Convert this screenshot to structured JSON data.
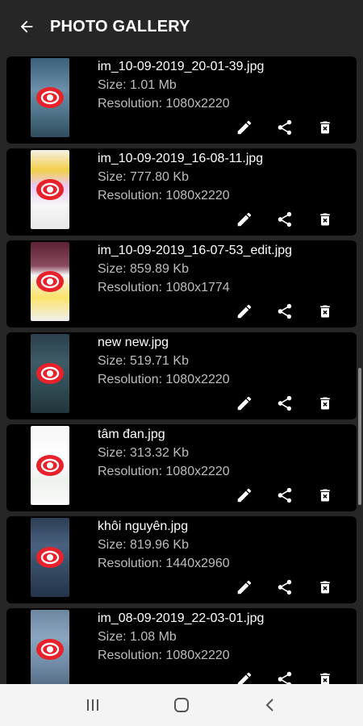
{
  "appbar": {
    "title": "PHOTO GALLERY",
    "back_icon": "arrow-back-icon"
  },
  "icons": {
    "edit": "pencil-icon",
    "share": "share-icon",
    "delete": "trash-icon"
  },
  "colors": {
    "background": "#262626",
    "card": "#000000",
    "eye_red": "#e8212b"
  },
  "photos": [
    {
      "name": "im_10-09-2019_20-01-39.jpg",
      "size": "Size: 1.01 Mb",
      "resolution": "Resolution: 1080x2220"
    },
    {
      "name": "im_10-09-2019_16-08-11.jpg",
      "size": "Size: 777.80 Kb",
      "resolution": "Resolution: 1080x2220"
    },
    {
      "name": "im_10-09-2019_16-07-53_edit.jpg",
      "size": "Size: 859.89 Kb",
      "resolution": "Resolution: 1080x1774"
    },
    {
      "name": "new new.jpg",
      "size": "Size: 519.71 Kb",
      "resolution": "Resolution: 1080x2220"
    },
    {
      "name": "tâm đan.jpg",
      "size": "Size: 313.32 Kb",
      "resolution": "Resolution: 1080x2220"
    },
    {
      "name": "khôi nguyên.jpg",
      "size": "Size: 819.96 Kb",
      "resolution": "Resolution: 1440x2960"
    },
    {
      "name": "im_08-09-2019_22-03-01.jpg",
      "size": "Size: 1.08 Mb",
      "resolution": "Resolution: 1080x2220"
    }
  ],
  "navbar": {
    "recents_icon": "recents-icon",
    "home_icon": "home-icon",
    "back_icon": "nav-back-icon"
  }
}
